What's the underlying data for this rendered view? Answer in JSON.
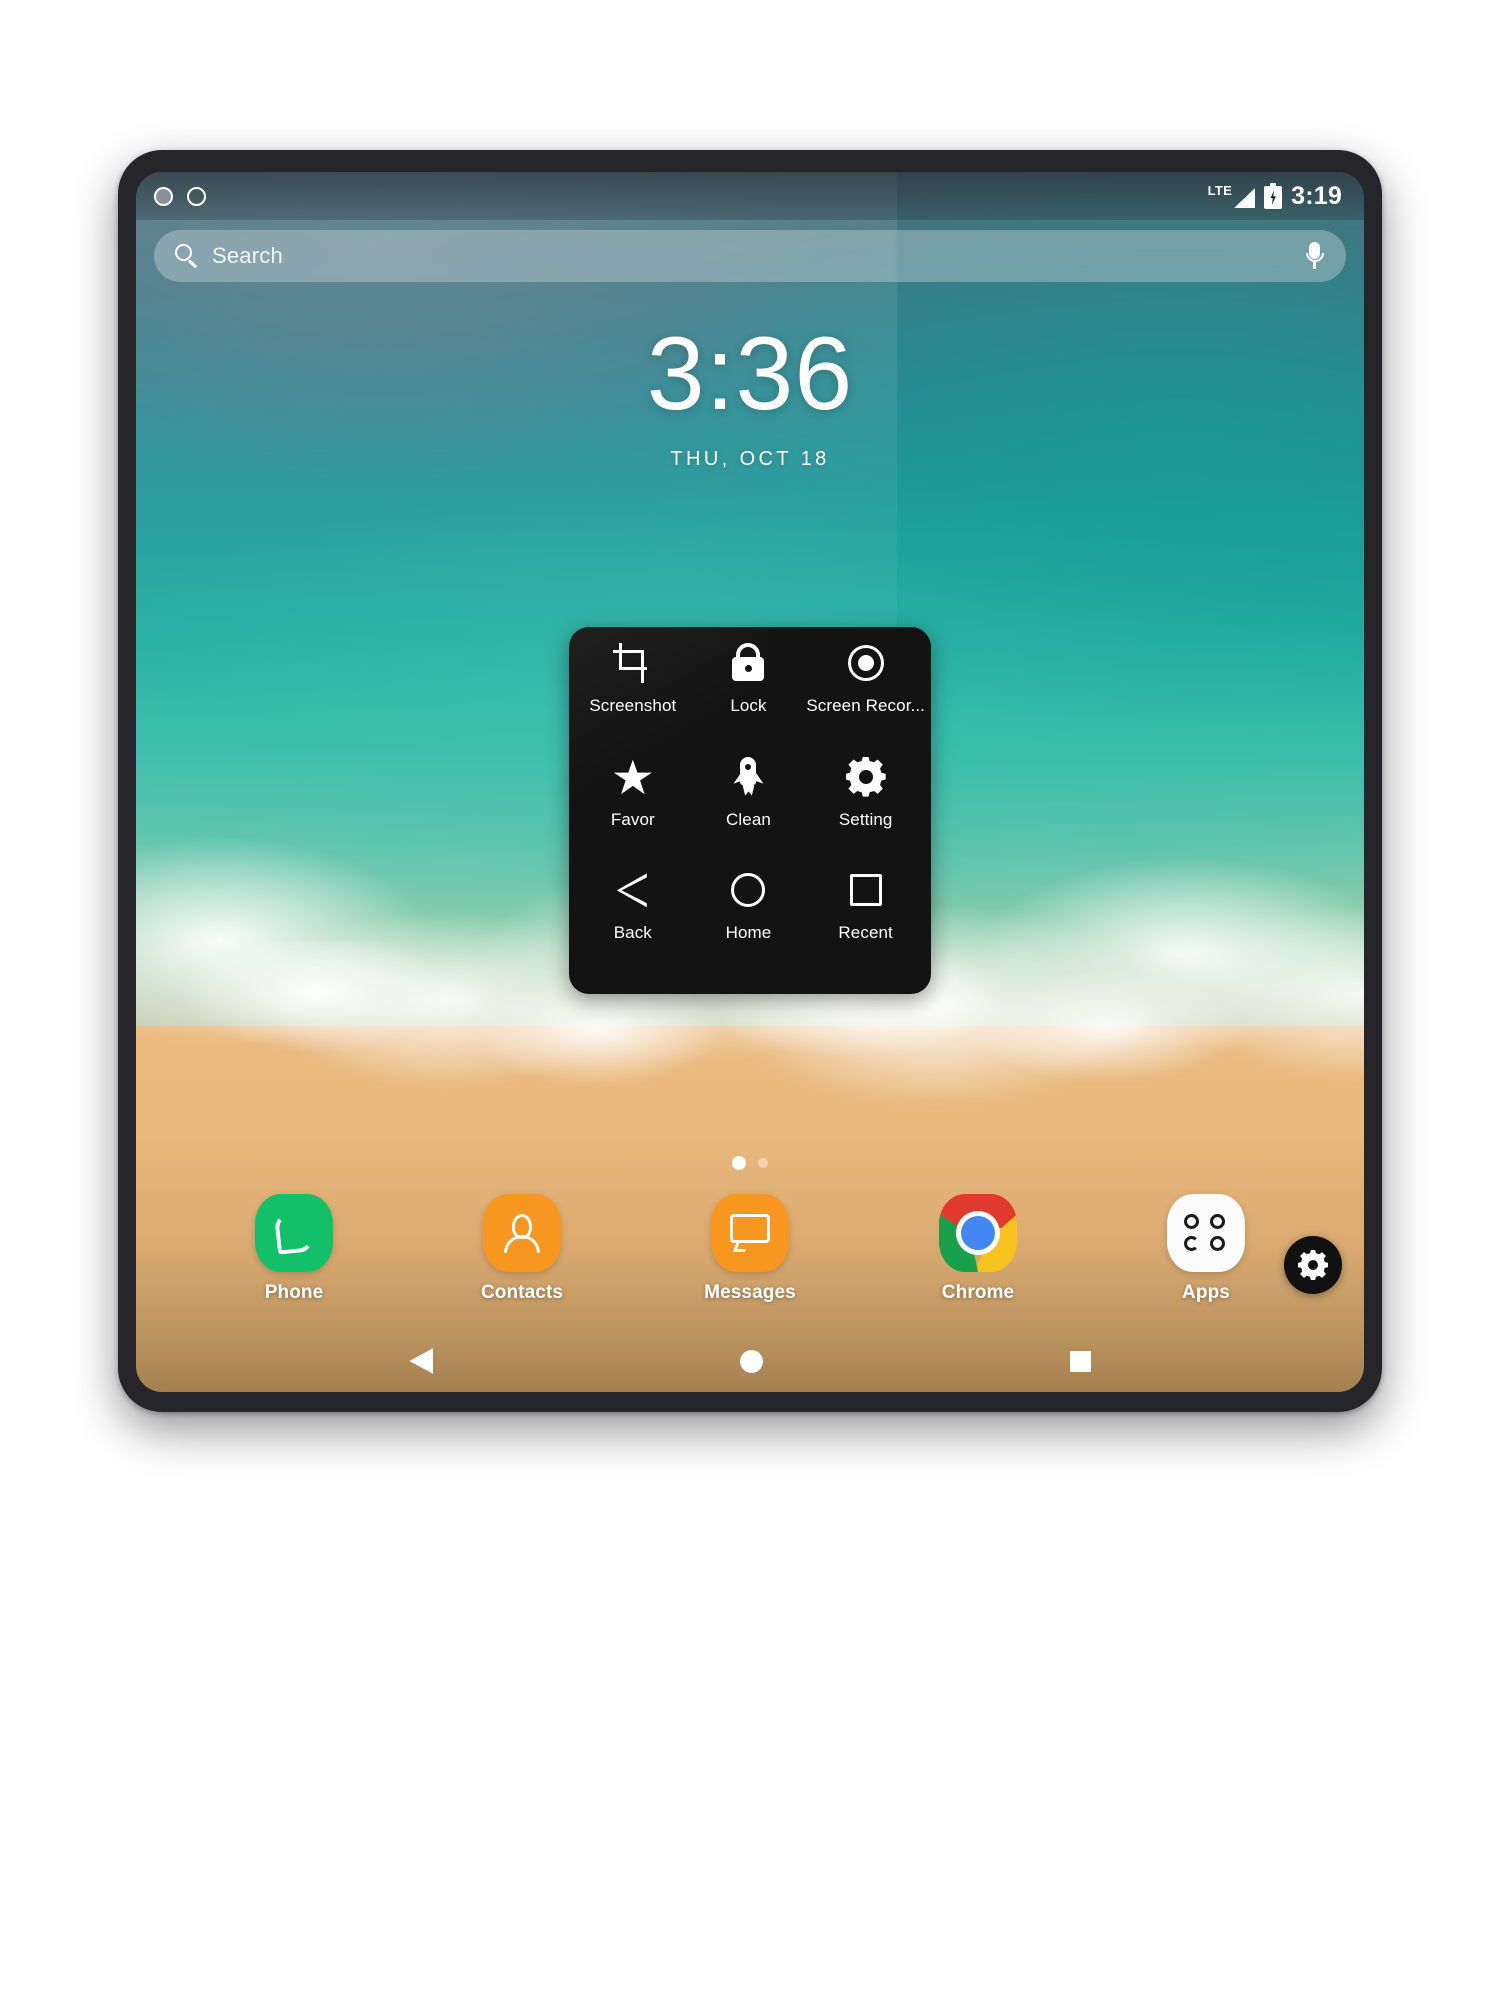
{
  "status_bar": {
    "left_icons": [
      "circle-filled-indicator",
      "circle-outline-indicator"
    ],
    "network_label": "LTE",
    "signal_icon": "signal-bars-icon",
    "battery_icon": "battery-charging-icon",
    "time": "3:19"
  },
  "search": {
    "placeholder": "Search",
    "search_icon": "search-icon",
    "mic_icon": "microphone-icon"
  },
  "clock_widget": {
    "time": "3:36",
    "date": "THU, OCT 18"
  },
  "assistive_panel": {
    "items": [
      {
        "label": "Screenshot",
        "icon": "crop-icon"
      },
      {
        "label": "Lock",
        "icon": "lock-icon"
      },
      {
        "label": "Screen Recor...",
        "icon": "record-icon"
      },
      {
        "label": "Favor",
        "icon": "star-icon"
      },
      {
        "label": "Clean",
        "icon": "rocket-icon"
      },
      {
        "label": "Setting",
        "icon": "gear-icon"
      },
      {
        "label": "Back",
        "icon": "triangle-left-icon"
      },
      {
        "label": "Home",
        "icon": "circle-outline-icon"
      },
      {
        "label": "Recent",
        "icon": "square-outline-icon"
      }
    ],
    "background_color": "#131313"
  },
  "page_indicator": {
    "total": 2,
    "active_index": 0
  },
  "dock": {
    "apps": [
      {
        "label": "Phone",
        "icon": "phone-handset-icon",
        "color": "#12c06a"
      },
      {
        "label": "Contacts",
        "icon": "contact-person-icon",
        "color": "#f89720"
      },
      {
        "label": "Messages",
        "icon": "chat-bubble-icon",
        "color": "#f89720"
      },
      {
        "label": "Chrome",
        "icon": "chrome-logo-icon",
        "color": "#4486f4"
      },
      {
        "label": "Apps",
        "icon": "apps-grid-icon",
        "color": "#fbfbfb"
      }
    ]
  },
  "floating_button": {
    "icon": "gear-icon",
    "color": "#111111"
  },
  "navigation_bar": {
    "buttons": [
      {
        "name": "back",
        "icon": "triangle-left-filled-icon"
      },
      {
        "name": "home",
        "icon": "circle-filled-icon"
      },
      {
        "name": "recent",
        "icon": "square-filled-icon"
      }
    ]
  },
  "wallpaper": {
    "description": "aerial beach with turquoise ocean and sand",
    "sea_color": "#21ad9f",
    "sand_color": "#eab97d"
  }
}
